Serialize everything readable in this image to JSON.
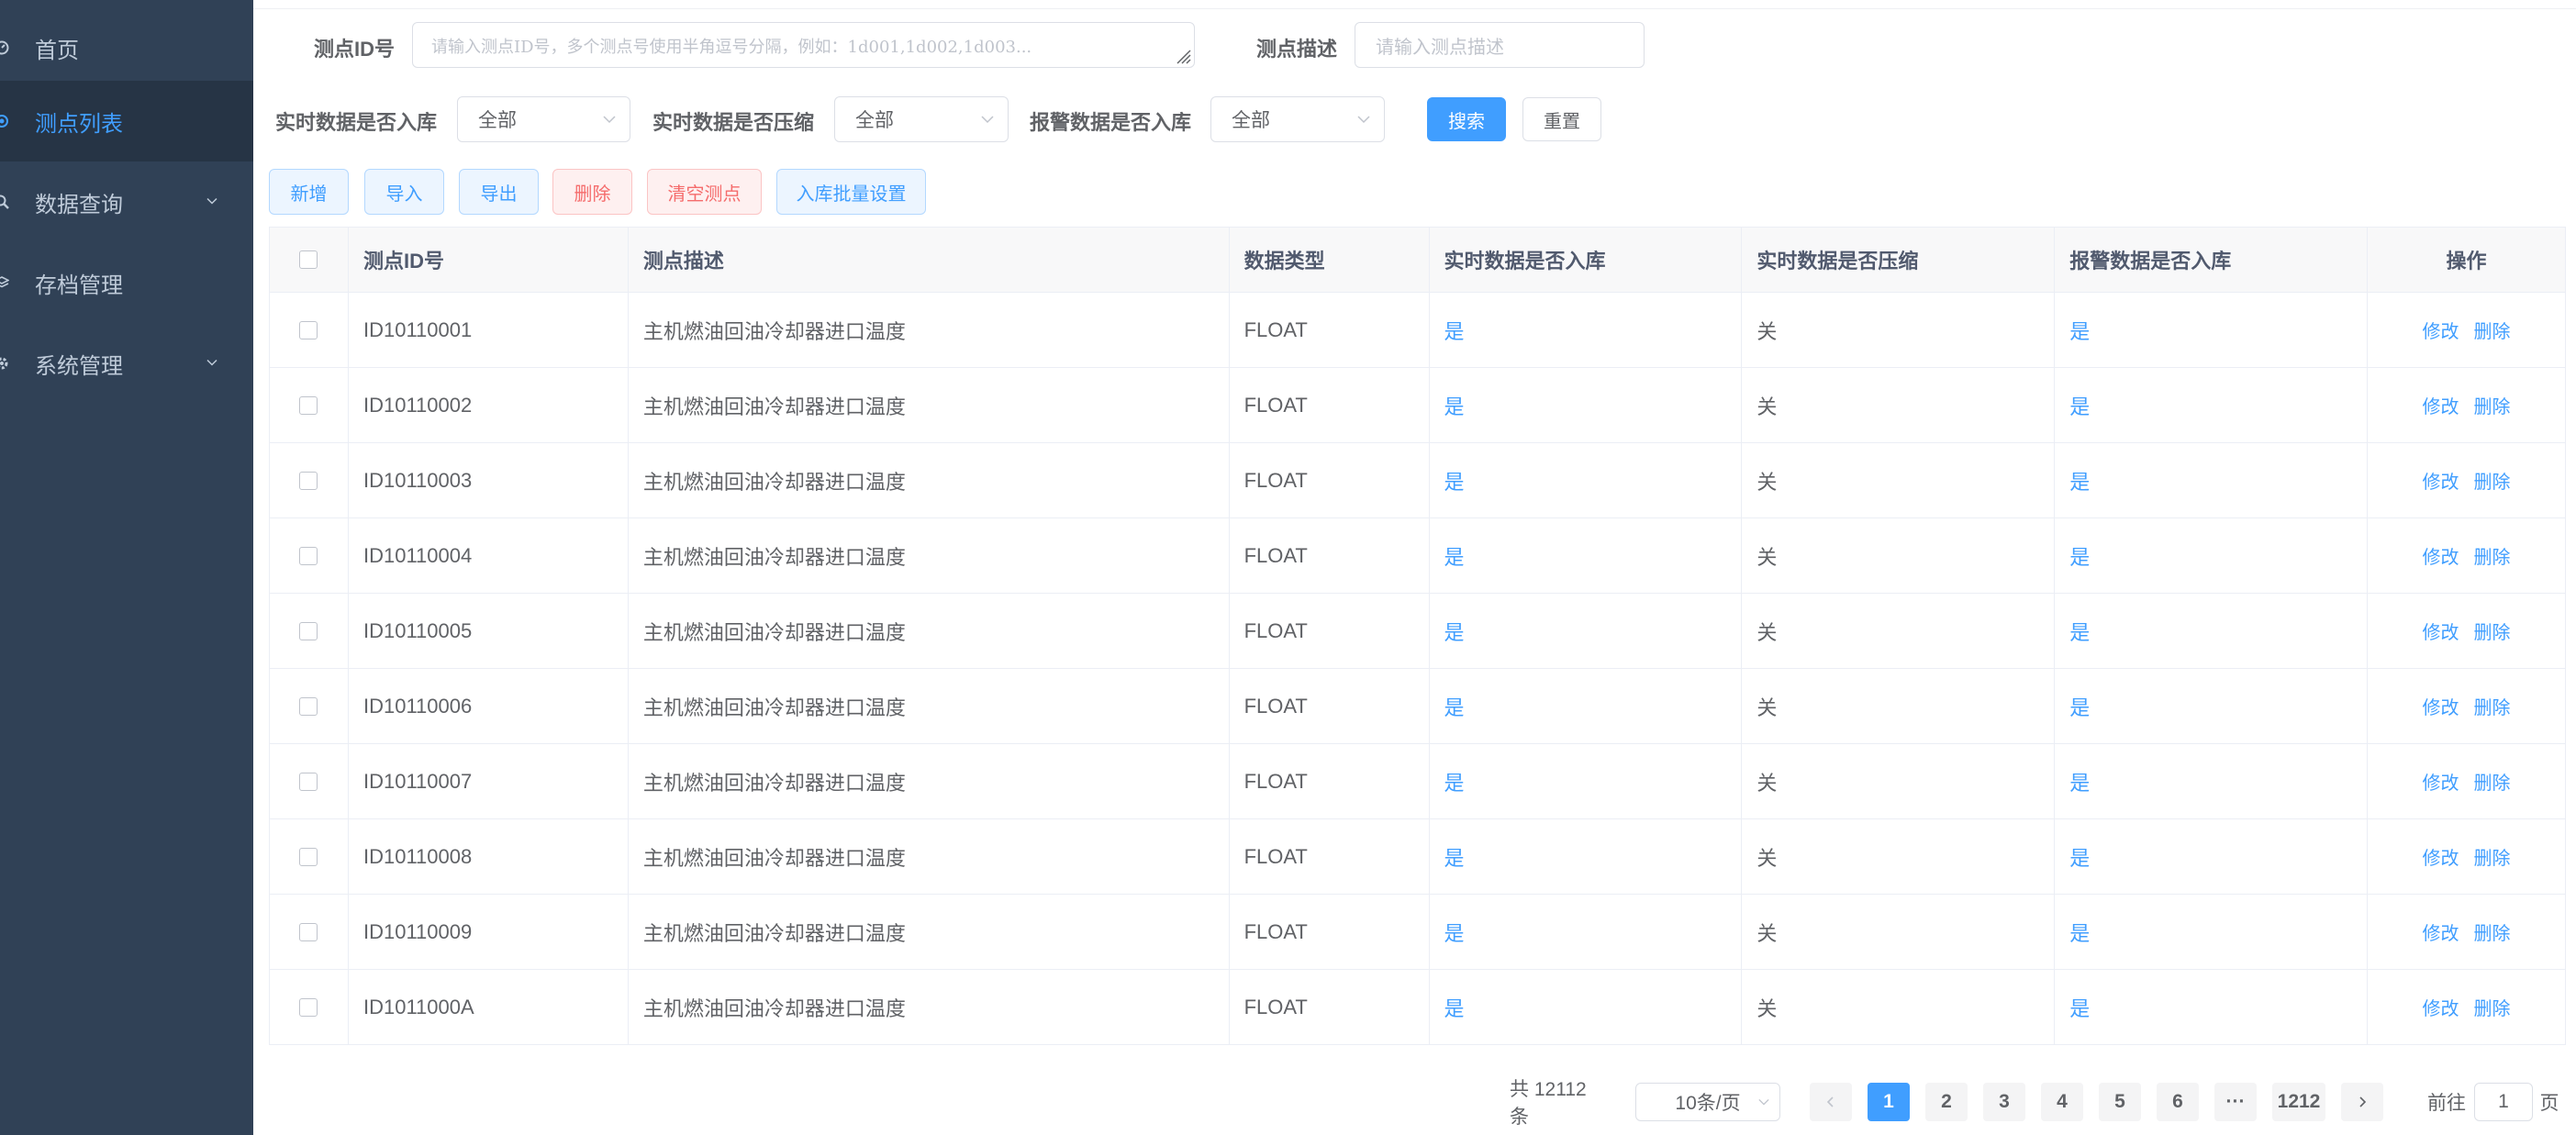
{
  "sidebar": {
    "items": [
      {
        "label": "首页",
        "icon": "dashboard-icon"
      },
      {
        "label": "测点列表",
        "icon": "dot-icon",
        "active": true
      },
      {
        "label": "数据查询",
        "icon": "search-icon",
        "has_submenu": true
      },
      {
        "label": "存档管理",
        "icon": "layers-icon"
      },
      {
        "label": "系统管理",
        "icon": "gear-icon",
        "has_submenu": true
      }
    ]
  },
  "filters": {
    "id_label": "测点ID号",
    "id_placeholder": "请输入测点ID号，多个测点号使用半角逗号分隔，例如：1d001,1d002,1d003...",
    "desc_label": "测点描述",
    "desc_placeholder": "请输入测点描述",
    "realtime_store_label": "实时数据是否入库",
    "realtime_store_value": "全部",
    "realtime_compress_label": "实时数据是否压缩",
    "realtime_compress_value": "全部",
    "alarm_store_label": "报警数据是否入库",
    "alarm_store_value": "全部",
    "search_label": "搜索",
    "reset_label": "重置"
  },
  "toolbar": {
    "add_label": "新增",
    "import_label": "导入",
    "export_label": "导出",
    "delete_label": "删除",
    "clear_label": "清空测点",
    "batch_label": "入库批量设置"
  },
  "table": {
    "headers": [
      "测点ID号",
      "测点描述",
      "数据类型",
      "实时数据是否入库",
      "实时数据是否压缩",
      "报警数据是否入库",
      "操作"
    ],
    "edit_label": "修改",
    "delete_label": "删除",
    "rows": [
      {
        "id": "ID10110001",
        "desc": "主机燃油回油冷却器进口温度",
        "type": "FLOAT",
        "rt_store": "是",
        "rt_compress": "关",
        "alarm_store": "是"
      },
      {
        "id": "ID10110002",
        "desc": "主机燃油回油冷却器进口温度",
        "type": "FLOAT",
        "rt_store": "是",
        "rt_compress": "关",
        "alarm_store": "是"
      },
      {
        "id": "ID10110003",
        "desc": "主机燃油回油冷却器进口温度",
        "type": "FLOAT",
        "rt_store": "是",
        "rt_compress": "关",
        "alarm_store": "是"
      },
      {
        "id": "ID10110004",
        "desc": "主机燃油回油冷却器进口温度",
        "type": "FLOAT",
        "rt_store": "是",
        "rt_compress": "关",
        "alarm_store": "是"
      },
      {
        "id": "ID10110005",
        "desc": "主机燃油回油冷却器进口温度",
        "type": "FLOAT",
        "rt_store": "是",
        "rt_compress": "关",
        "alarm_store": "是"
      },
      {
        "id": "ID10110006",
        "desc": "主机燃油回油冷却器进口温度",
        "type": "FLOAT",
        "rt_store": "是",
        "rt_compress": "关",
        "alarm_store": "是"
      },
      {
        "id": "ID10110007",
        "desc": "主机燃油回油冷却器进口温度",
        "type": "FLOAT",
        "rt_store": "是",
        "rt_compress": "关",
        "alarm_store": "是"
      },
      {
        "id": "ID10110008",
        "desc": "主机燃油回油冷却器进口温度",
        "type": "FLOAT",
        "rt_store": "是",
        "rt_compress": "关",
        "alarm_store": "是"
      },
      {
        "id": "ID10110009",
        "desc": "主机燃油回油冷却器进口温度",
        "type": "FLOAT",
        "rt_store": "是",
        "rt_compress": "关",
        "alarm_store": "是"
      },
      {
        "id": "ID1011000A",
        "desc": "主机燃油回油冷却器进口温度",
        "type": "FLOAT",
        "rt_store": "是",
        "rt_compress": "关",
        "alarm_store": "是"
      }
    ]
  },
  "pagination": {
    "total_text": "共 12112 条",
    "page_size": "10条/页",
    "pages": [
      "1",
      "2",
      "3",
      "4",
      "5",
      "6"
    ],
    "ellipsis": "···",
    "last_page": "1212",
    "current_page": "1",
    "goto_prefix": "前往",
    "goto_value": "1",
    "goto_suffix": "页"
  },
  "colors": {
    "sidebar_bg": "#304156",
    "sidebar_active_bg": "#263445",
    "accent": "#409eff",
    "danger": "#f56c6c"
  }
}
